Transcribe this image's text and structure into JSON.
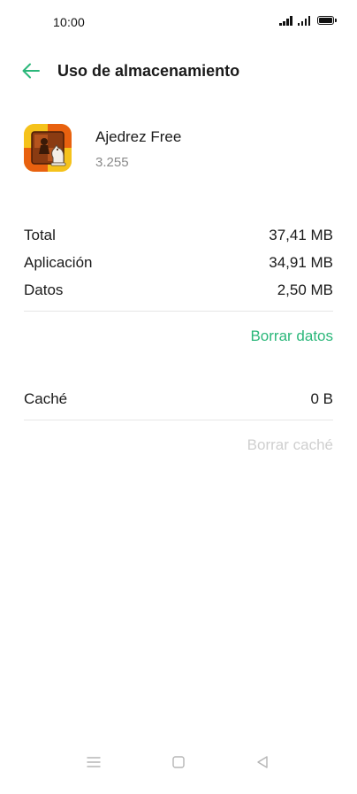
{
  "status_bar": {
    "time": "10:00",
    "icons": [
      "signal-icon",
      "signal-icon",
      "battery-icon"
    ]
  },
  "header": {
    "back_icon": "arrow-left-icon",
    "title": "Uso de almacenamiento"
  },
  "app": {
    "icon": "chess-app-icon",
    "name": "Ajedrez Free",
    "version": "3.255"
  },
  "storage": [
    {
      "label": "Total",
      "value": "37,41 MB"
    },
    {
      "label": "Aplicación",
      "value": "34,91 MB"
    },
    {
      "label": "Datos",
      "value": "2,50 MB"
    }
  ],
  "clear_data_label": "Borrar datos",
  "cache": {
    "label": "Caché",
    "value": "0 B"
  },
  "clear_cache_label": "Borrar caché",
  "colors": {
    "accent": "#2bb77a",
    "disabled": "#cfcfcf",
    "secondary_text": "#8a8a8a"
  },
  "nav_bar": {
    "icons": [
      "menu-icon",
      "home-icon",
      "back-triangle-icon"
    ]
  }
}
